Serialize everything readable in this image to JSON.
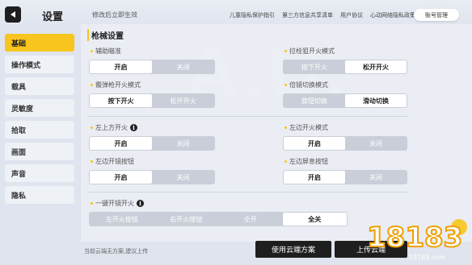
{
  "header": {
    "title": "设置",
    "hint": "修改后立即生效",
    "links": [
      "儿童隐私保护指引",
      "第三方信息共享清单",
      "用户协议",
      "心动网络隐私政策"
    ],
    "account_button": "账号管理"
  },
  "sidebar": {
    "items": [
      {
        "label": "基础",
        "active": true
      },
      {
        "label": "操作模式",
        "active": false
      },
      {
        "label": "载具",
        "active": false
      },
      {
        "label": "灵敏度",
        "active": false
      },
      {
        "label": "拾取",
        "active": false
      },
      {
        "label": "画面",
        "active": false
      },
      {
        "label": "声音",
        "active": false
      },
      {
        "label": "隐私",
        "active": false
      }
    ]
  },
  "main": {
    "section_title": "枪械设置",
    "settings": {
      "auxiliary_aim": {
        "label": "辅助瞄准",
        "options": [
          "开启",
          "关闭"
        ],
        "selected": 0
      },
      "bolt_fire_mode": {
        "label": "拉栓狙开火模式",
        "options": [
          "按下开火",
          "松开开火"
        ],
        "selected": 1
      },
      "shotgun_fire_mode": {
        "label": "霰弹枪开火模式",
        "options": [
          "按下开火",
          "松开开火"
        ],
        "selected": 0
      },
      "scope_switch_mode": {
        "label": "倍镜切换模式",
        "options": [
          "旋钮切换",
          "滑动切换"
        ],
        "selected": 1
      },
      "top_left_fire": {
        "label": "左上方开火",
        "options": [
          "开启",
          "关闭"
        ],
        "selected": 0
      },
      "left_fire_mode": {
        "label": "左边开火模式",
        "options": [
          "开启",
          "关闭"
        ],
        "selected": 0
      },
      "left_scope_button": {
        "label": "左边开镜按钮",
        "options": [
          "开启",
          "关闭"
        ],
        "selected": 0
      },
      "left_breath_button": {
        "label": "左边屏息按钮",
        "options": [
          "开启",
          "关闭"
        ],
        "selected": 0
      },
      "one_key_scope_fire": {
        "label": "一键开镜开火",
        "options": [
          "左开火按钮",
          "右开火按钮",
          "全开",
          "全关"
        ],
        "selected": 3
      }
    }
  },
  "footer": {
    "note": "当前云端无方案,建议上传",
    "use_cloud_button": "使用云端方案",
    "upload_button": "上传云端"
  },
  "watermark": {
    "text": "18183",
    "site": "18183.com"
  },
  "colors": {
    "accent": "#f7c51e",
    "dark_button": "#1e1e1e",
    "segment_bg": "#c9ced8"
  }
}
